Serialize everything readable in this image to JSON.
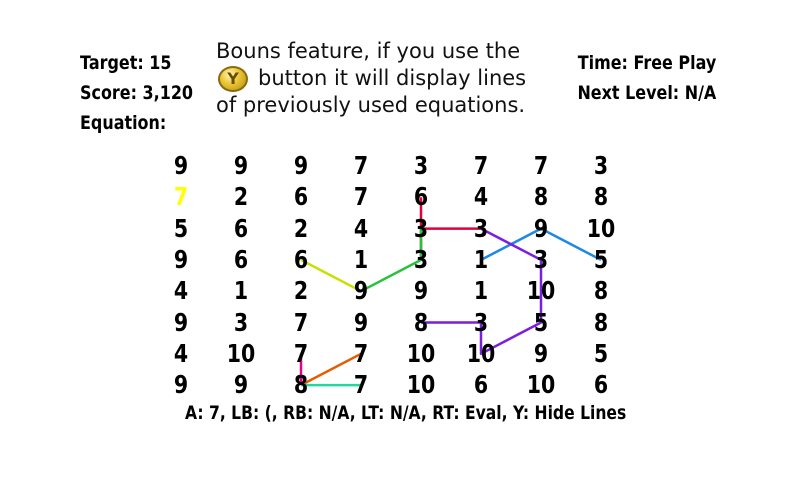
{
  "hud": {
    "target": "Target: 15",
    "score": "Score: 3,120",
    "equation": "Equation:",
    "time": "Time: Free Play",
    "next_level": "Next Level: N/A"
  },
  "tip": {
    "line1": "Bouns feature, if you use the",
    "button_label": "Y",
    "line2": "button it will display lines",
    "line3": "of previously used equations."
  },
  "grid": {
    "rows": [
      [
        "9",
        "9",
        "9",
        "7",
        "3",
        "7",
        "7",
        "3"
      ],
      [
        "7",
        "2",
        "6",
        "7",
        "6",
        "4",
        "8",
        "8"
      ],
      [
        "5",
        "6",
        "2",
        "4",
        "3",
        "3",
        "9",
        "10"
      ],
      [
        "9",
        "6",
        "6",
        "1",
        "3",
        "1",
        "3",
        "5"
      ],
      [
        "4",
        "1",
        "2",
        "9",
        "9",
        "1",
        "10",
        "8"
      ],
      [
        "9",
        "3",
        "7",
        "9",
        "8",
        "3",
        "5",
        "8"
      ],
      [
        "4",
        "10",
        "7",
        "7",
        "10",
        "10",
        "9",
        "5"
      ],
      [
        "9",
        "9",
        "8",
        "7",
        "10",
        "6",
        "10",
        "6"
      ]
    ],
    "highlight": {
      "row": 1,
      "col": 0,
      "color": "#ffff00"
    }
  },
  "paths": [
    {
      "color": "#e0003a",
      "cells": [
        [
          3,
          4
        ],
        [
          1,
          4
        ]
      ]
    },
    {
      "color": "#e0003a",
      "cells": [
        [
          2,
          4
        ],
        [
          2,
          5
        ]
      ]
    },
    {
      "color": "#27c23a",
      "cells": [
        [
          2,
          4
        ],
        [
          3,
          4
        ],
        [
          4,
          3
        ]
      ]
    },
    {
      "color": "#c8e000",
      "cells": [
        [
          4,
          3
        ],
        [
          3,
          2
        ]
      ]
    },
    {
      "color": "#1e88e5",
      "cells": [
        [
          3,
          5
        ],
        [
          2,
          6
        ],
        [
          3,
          7
        ]
      ]
    },
    {
      "color": "#7a1fe0",
      "cells": [
        [
          2,
          5
        ],
        [
          3,
          6
        ],
        [
          4,
          6
        ],
        [
          5,
          6
        ],
        [
          6,
          5
        ],
        [
          5,
          5
        ],
        [
          5,
          4
        ]
      ]
    },
    {
      "color": "#e6008a",
      "cells": [
        [
          6,
          2
        ],
        [
          7,
          2
        ]
      ]
    },
    {
      "color": "#e65c00",
      "cells": [
        [
          7,
          2
        ],
        [
          6,
          3
        ]
      ]
    },
    {
      "color": "#20d8a0",
      "cells": [
        [
          7,
          2
        ],
        [
          7,
          3
        ]
      ]
    }
  ],
  "controls": "A: 7, LB: (, RB: N/A, LT: N/A, RT: Eval, Y: Hide Lines"
}
